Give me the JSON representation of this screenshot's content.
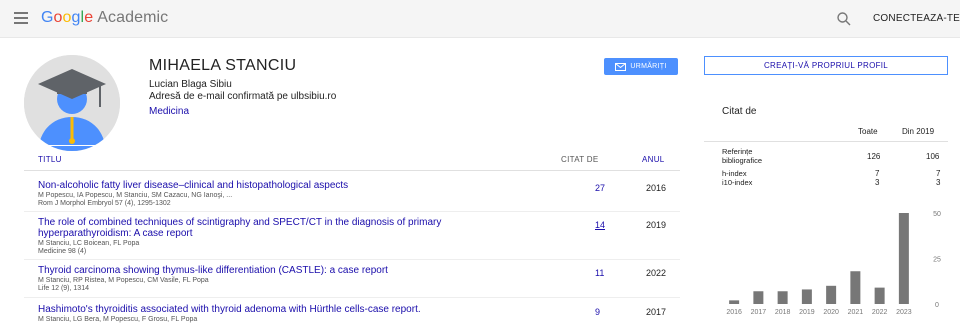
{
  "header": {
    "logo_letters": [
      "G",
      "o",
      "o",
      "g",
      "l",
      "e"
    ],
    "logo_suffix": "Academic",
    "connect_label": "CONECTEAZĂ-TE"
  },
  "profile": {
    "name": "MIHAELA STANCIU",
    "affiliation": "Lucian Blaga Sibiu",
    "email": "Adresă de e-mail confirmată pe ulbsibiu.ro",
    "interest": "Medicina",
    "follow_label": "URMĂRIȚI"
  },
  "table": {
    "col_title": "TITLU",
    "col_cited": "CITAT DE",
    "col_year": "ANUL",
    "articles": [
      {
        "title": "Non-alcoholic fatty liver disease–clinical and histopathological aspects",
        "authors": "M Popescu, IA Popescu, M Stanciu, SM Cazacu, NG Ianoşi, ...",
        "source": "Rom J Morphol Embryol 57 (4), 1295-1302",
        "cites": "27",
        "year": "2016"
      },
      {
        "title_line1": "The role of combined techniques of scintigraphy and SPECT/CT in the diagnosis of primary",
        "title_line2": "hyperparathyroidism: A case report",
        "authors": "M Stanciu, LC Boicean, FL Popa",
        "source": "Medicine 98 (4)",
        "cites": "14",
        "year": "2019"
      },
      {
        "title": "Thyroid carcinoma showing thymus-like differentiation (CASTLE): a case report",
        "authors": "M Stanciu, RP Ristea, M Popescu, CM Vasile, FL Popa",
        "source": "Life 12 (9), 1314",
        "cites": "11",
        "year": "2022"
      },
      {
        "title": "Hashimoto's thyroiditis associated with thyroid adenoma with Hürthle cells-case report.",
        "authors": "M Stanciu, LG Bera, M Popescu, F Grosu, FL Popa",
        "cites": "9",
        "year": "2017"
      }
    ]
  },
  "sidebar": {
    "create_profile_label": "CREAȚI-VĂ PROPRIUL PROFIL",
    "cited_by_title": "Citat de",
    "col_all": "Toate",
    "col_since": "Din 2019",
    "metrics": [
      {
        "label_line1": "Referințe",
        "label_line2": "bibliografice",
        "all": "126",
        "since": "106"
      },
      {
        "label_line1": "h-index",
        "all": "7",
        "since": "7"
      },
      {
        "label_line1": "i10-index",
        "all": "3",
        "since": "3"
      }
    ]
  },
  "chart_data": {
    "type": "bar",
    "categories": [
      "2016",
      "2017",
      "2018",
      "2019",
      "2020",
      "2021",
      "2022",
      "2023"
    ],
    "values": [
      2,
      7,
      7,
      8,
      10,
      18,
      9,
      50
    ],
    "ylim": [
      0,
      50
    ],
    "yticks": [
      "50",
      "25",
      "0"
    ],
    "bar_color": "#777777",
    "grid": false
  },
  "colors": {
    "link": "#1a0dab",
    "accent_button": "#4d90fe",
    "topbar_bg": "#f5f5f5"
  }
}
